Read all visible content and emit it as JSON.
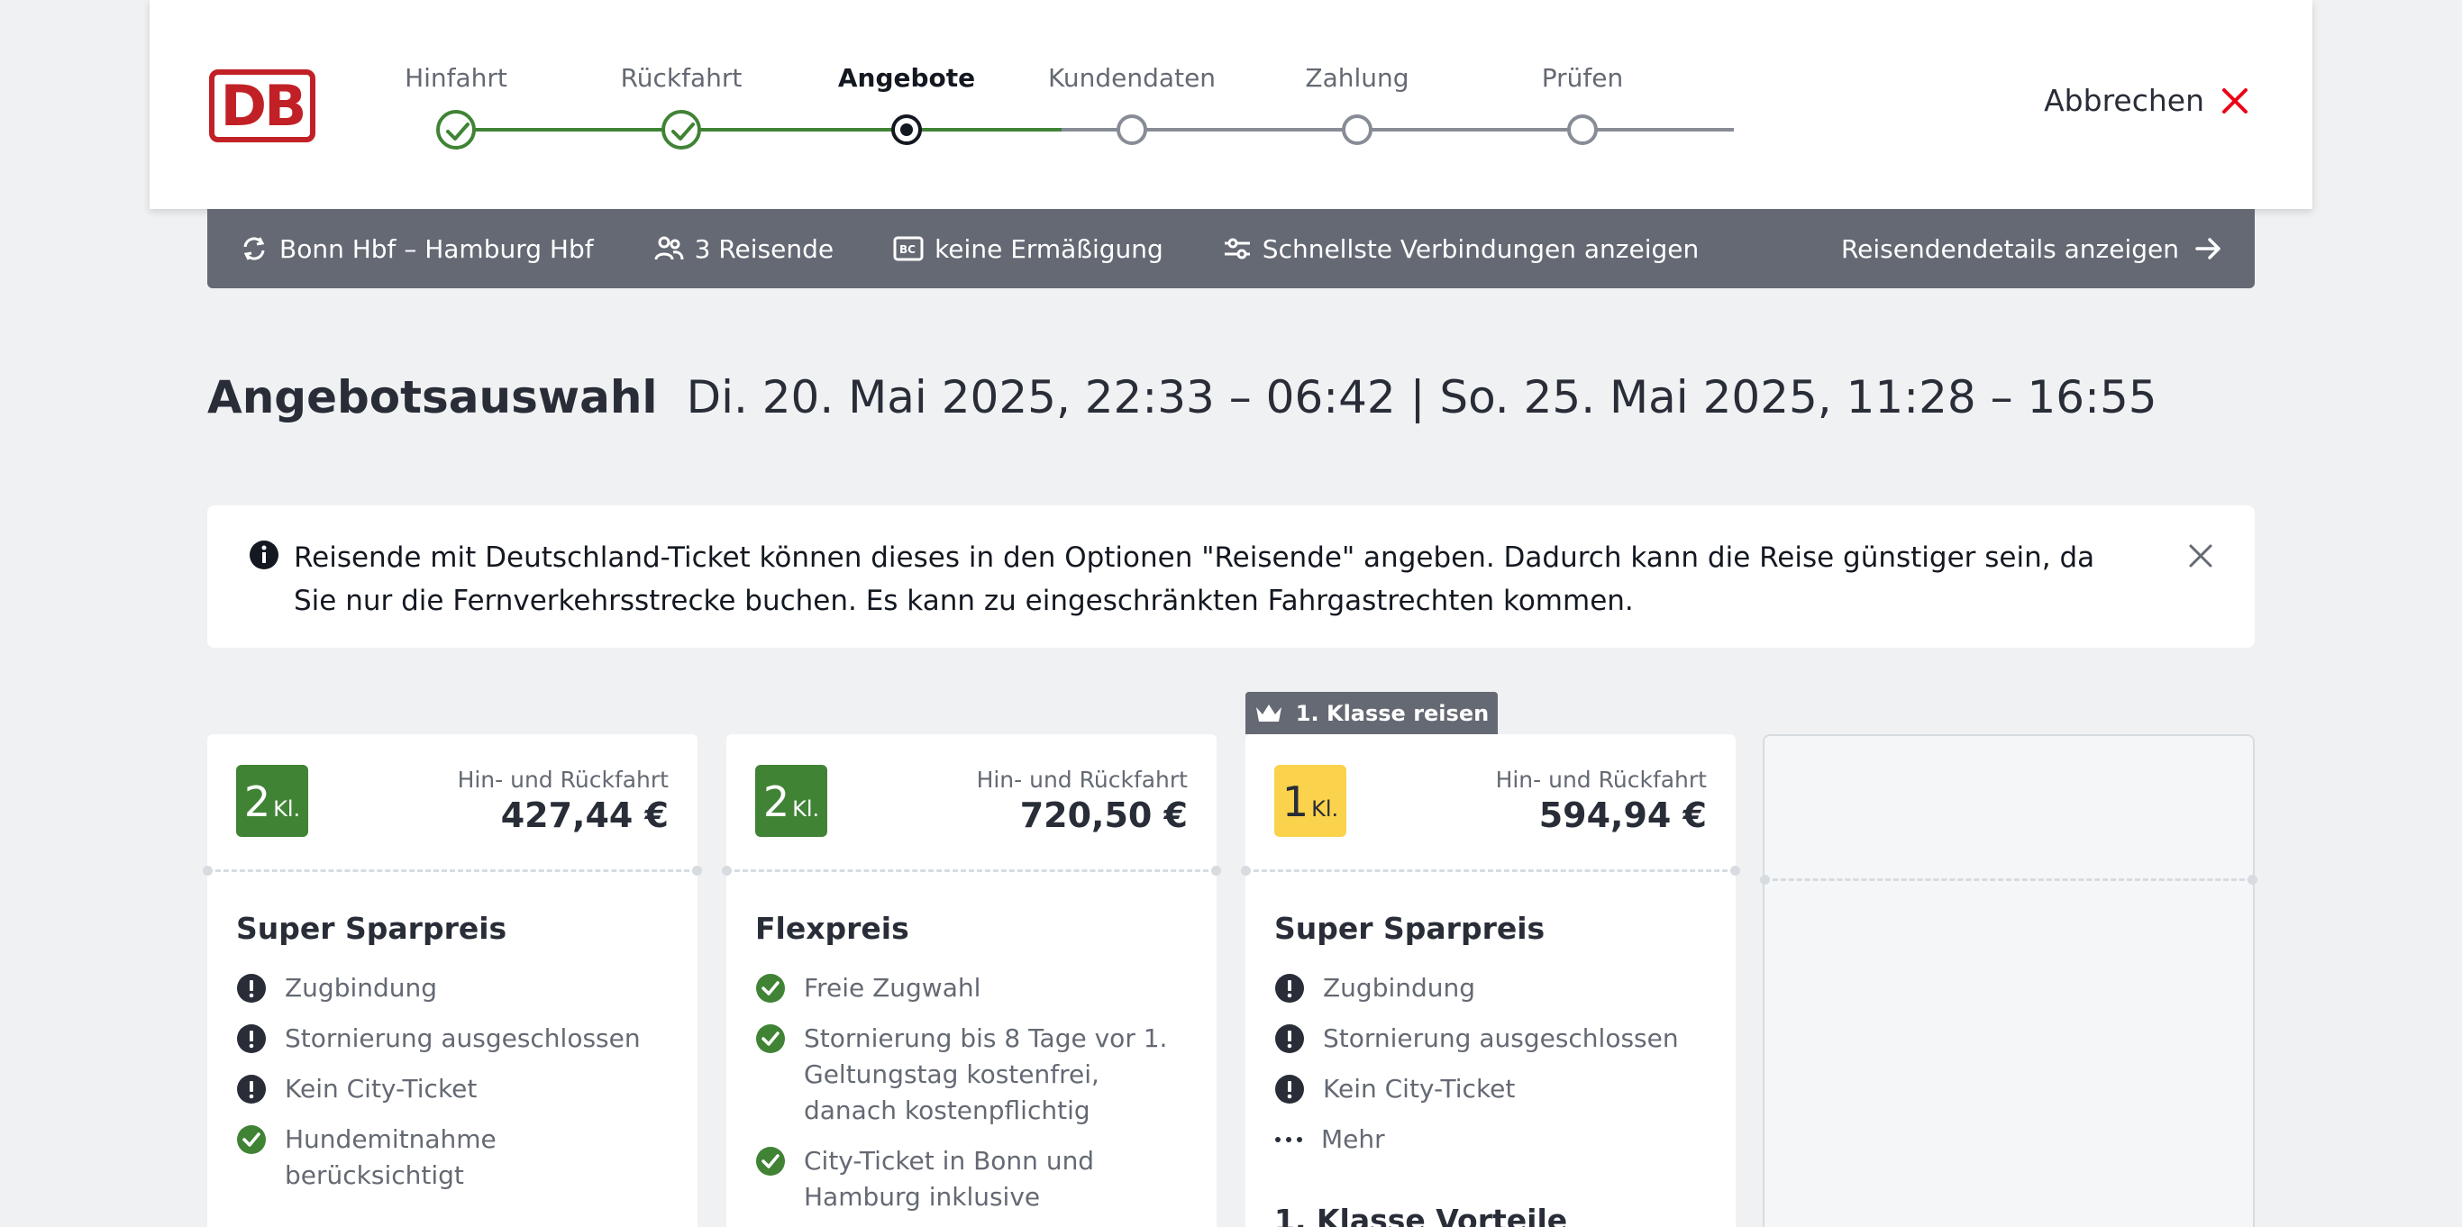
{
  "header": {
    "logo_text": "DB",
    "steps": [
      {
        "label": "Hinfahrt",
        "state": "done"
      },
      {
        "label": "Rückfahrt",
        "state": "done"
      },
      {
        "label": "Angebote",
        "state": "current"
      },
      {
        "label": "Kundendaten",
        "state": "todo"
      },
      {
        "label": "Zahlung",
        "state": "todo"
      },
      {
        "label": "Prüfen",
        "state": "todo"
      }
    ],
    "cancel_label": "Abbrechen"
  },
  "search_bar": {
    "route": "Bonn Hbf – Hamburg Hbf",
    "travelers": "3 Reisende",
    "discount": "keine Ermäßigung",
    "fastest": "Schnellste Verbindungen anzeigen",
    "details_link": "Reisendendetails anzeigen"
  },
  "page": {
    "title": "Angebotsauswahl",
    "dates": "Di. 20. Mai 2025, 22:33 – 06:42 | So. 25. Mai 2025, 11:28 – 16:55"
  },
  "info": {
    "text": "Reisende mit Deutschland-Ticket können dieses in den Optionen \"Reisende\" angeben. Dadurch kann die Reise günstiger sein, da Sie nur die Fernverkehrsstrecke buchen. Es kann zu eingeschränkten Fahrgastrechten kommen."
  },
  "first_class_badge": "1. Klasse reisen",
  "offers": [
    {
      "class_num": "2",
      "class_suffix": "Kl.",
      "fare_label": "Hin- und Rückfahrt",
      "price": "427,44 €",
      "name": "Super Sparpreis",
      "features": [
        {
          "icon": "warning-icon",
          "text": "Zugbindung"
        },
        {
          "icon": "warning-icon",
          "text": "Stornierung ausgeschlossen"
        },
        {
          "icon": "warning-icon",
          "text": "Kein City-Ticket"
        },
        {
          "icon": "check-icon",
          "text": "Hundemitnahme berücksichtigt"
        }
      ]
    },
    {
      "class_num": "2",
      "class_suffix": "Kl.",
      "fare_label": "Hin- und Rückfahrt",
      "price": "720,50 €",
      "name": "Flexpreis",
      "features": [
        {
          "icon": "check-icon",
          "text": "Freie Zugwahl"
        },
        {
          "icon": "check-icon",
          "text": "Stornierung bis 8 Tage vor 1. Geltungstag kostenfrei, danach kostenpflichtig"
        },
        {
          "icon": "check-icon",
          "text": "City-Ticket in Bonn und Hamburg inklusive"
        }
      ]
    },
    {
      "class_num": "1",
      "class_suffix": "Kl.",
      "fare_label": "Hin- und Rückfahrt",
      "price": "594,94 €",
      "name": "Super Sparpreis",
      "features": [
        {
          "icon": "warning-icon",
          "text": "Zugbindung"
        },
        {
          "icon": "warning-icon",
          "text": "Stornierung ausgeschlossen"
        },
        {
          "icon": "warning-icon",
          "text": "Kein City-Ticket"
        }
      ],
      "more_label": "Mehr",
      "subhead": "1. Klasse Vorteile"
    }
  ],
  "colors": {
    "db_red": "#c12126",
    "done_green": "#408335",
    "class1_yellow": "#fad24b",
    "bar_gray": "#646973"
  }
}
